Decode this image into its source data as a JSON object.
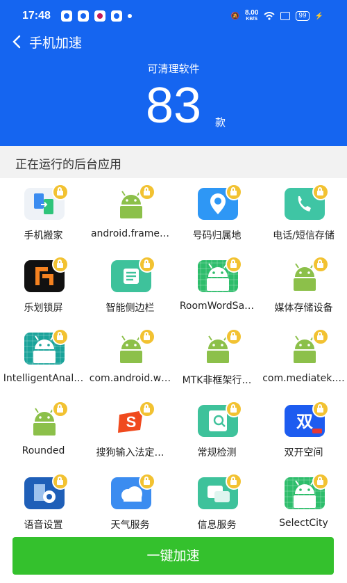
{
  "status_bar": {
    "time": "17:48",
    "speed_value": "8.00",
    "speed_unit": "KB/S",
    "battery": "99"
  },
  "nav": {
    "back_icon": "chevron-left-icon",
    "title": "手机加速"
  },
  "summary": {
    "subtitle": "可清理软件",
    "count": "83",
    "unit": "款"
  },
  "section_title": "正在运行的后台应用",
  "apps": [
    {
      "label": "手机搬家",
      "icon": "phone-transfer-icon",
      "color": "#eef2f7"
    },
    {
      "label": "android.frame…",
      "icon": "android-icon",
      "color": "#ffffff"
    },
    {
      "label": "号码归属地",
      "icon": "location-pin-icon",
      "color": "#2e97f5"
    },
    {
      "label": "电话/短信存储",
      "icon": "phone-call-icon",
      "color": "#3fc5a4"
    },
    {
      "label": "乐划锁屏",
      "icon": "lockscreen-icon",
      "color": "#111111"
    },
    {
      "label": "智能侧边栏",
      "icon": "sidebar-icon",
      "color": "#3ec29b"
    },
    {
      "label": "RoomWordSa…",
      "icon": "android-grid-icon",
      "color": "#2ebd6b"
    },
    {
      "label": "媒体存储设备",
      "icon": "android-icon",
      "color": "#ffffff"
    },
    {
      "label": "IntelligentAnal…",
      "icon": "android-grid-icon",
      "color": "#1aa39a"
    },
    {
      "label": "com.android.w…",
      "icon": "android-icon",
      "color": "#ffffff"
    },
    {
      "label": "MTK非框架行…",
      "icon": "android-icon",
      "color": "#ffffff"
    },
    {
      "label": "com.mediatek.…",
      "icon": "android-icon",
      "color": "#ffffff"
    },
    {
      "label": "Rounded",
      "icon": "android-icon",
      "color": "#ffffff"
    },
    {
      "label": "搜狗输入法定…",
      "icon": "sogou-icon",
      "color": "#ffffff"
    },
    {
      "label": "常规检测",
      "icon": "inspection-icon",
      "color": "#3ec29b"
    },
    {
      "label": "双开空间",
      "icon": "dual-space-icon",
      "color": "#1d5cf0"
    },
    {
      "label": "语音设置",
      "icon": "voice-settings-icon",
      "color": "#1f5fb8"
    },
    {
      "label": "天气服务",
      "icon": "weather-cloud-icon",
      "color": "#3b8cf0"
    },
    {
      "label": "信息服务",
      "icon": "message-icon",
      "color": "#3ec29b"
    },
    {
      "label": "SelectCity",
      "icon": "android-grid-icon",
      "color": "#2ebd6b"
    }
  ],
  "action_button": {
    "label": "一键加速",
    "color": "#34c12d"
  },
  "colors": {
    "header": "#1565f0",
    "lock_badge": "#f2c232",
    "android_green": "#8cc04a"
  }
}
